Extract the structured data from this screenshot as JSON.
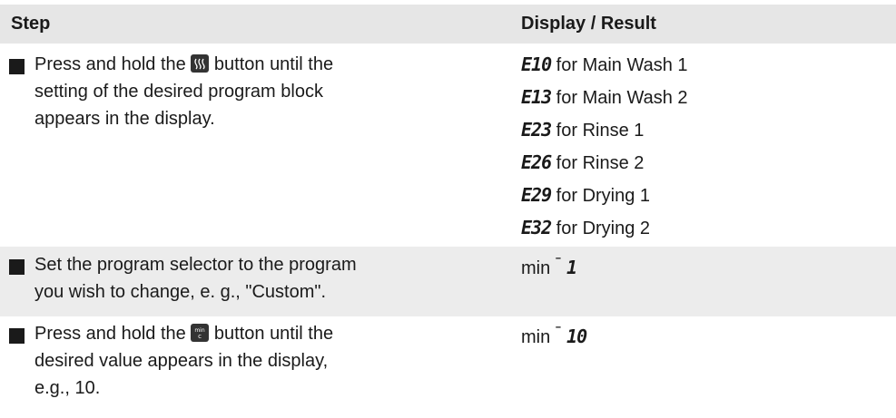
{
  "header": {
    "step": "Step",
    "result": "Display / Result"
  },
  "rows": [
    {
      "step_parts": [
        "Press and hold the ",
        " button until the",
        "setting of the desired program block",
        "appears in the display."
      ],
      "step_icon": "heat-steam-icon",
      "results": [
        {
          "code": "E10",
          "text": " for Main Wash 1"
        },
        {
          "code": "E13",
          "text": " for Main Wash 2"
        },
        {
          "code": "E23",
          "text": " for Rinse 1"
        },
        {
          "code": "E26",
          "text": " for Rinse 2"
        },
        {
          "code": "E29",
          "text": " for Drying 1"
        },
        {
          "code": "E32",
          "text": " for Drying 2"
        }
      ]
    },
    {
      "step_parts": [
        "Set the program selector to the program",
        "you wish to change, e. g., \"Custom\"."
      ],
      "result_prefix": "min ",
      "result_dash": "ˉ",
      "result_code": "1"
    },
    {
      "step_parts": [
        "Press and hold the ",
        " button until the",
        "desired value appears in the display,",
        "e.g., 10."
      ],
      "step_icon": "min-c-icon",
      "result_prefix": "min ",
      "result_dash": "ˉ",
      "result_code": "10"
    }
  ]
}
